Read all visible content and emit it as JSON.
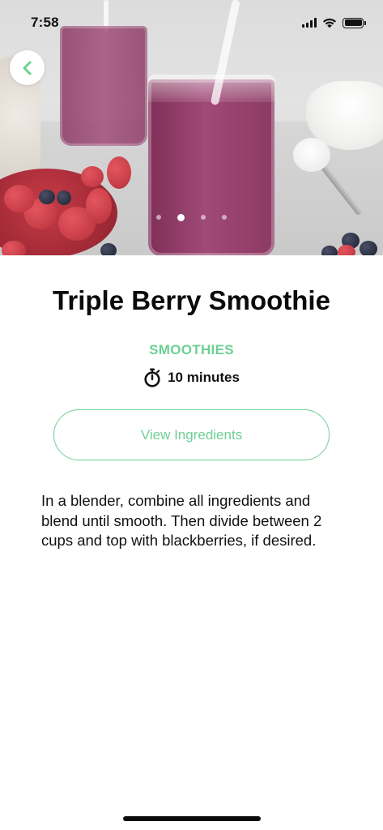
{
  "status_bar": {
    "time": "7:58"
  },
  "hero": {
    "image_description_icon": "smoothie-photo",
    "page_count": 4,
    "active_page_index": 1
  },
  "navigation": {
    "back_icon": "chevron-left-icon"
  },
  "recipe": {
    "title": "Triple Berry Smoothie",
    "category": "SMOOTHIES",
    "duration": "10 minutes",
    "view_ingredients_label": "View Ingredients",
    "instructions": "In a blender, combine all ingredients and blend until smooth. Then divide between 2 cups and top with blackberries, if desired."
  },
  "colors": {
    "accent": "#6ecf95",
    "text_primary": "#0b0b0b",
    "background": "#ffffff"
  }
}
